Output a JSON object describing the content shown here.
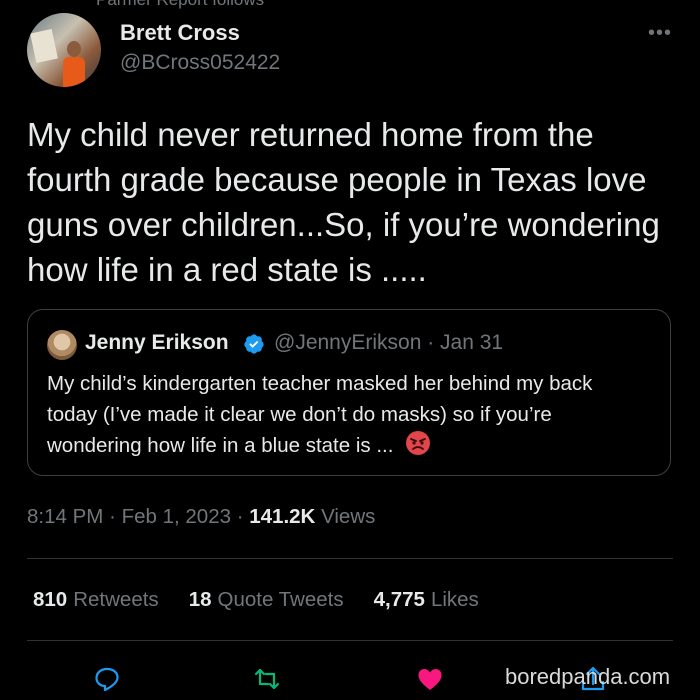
{
  "top_cut_text": "Parmer Report follows",
  "author": {
    "name": "Brett Cross",
    "handle": "@BCross052422"
  },
  "more_icon": "more-horizontal-icon",
  "tweet_text": "My child never returned home from the fourth grade because people in Texas love guns over children...So, if you’re wondering how life in a red state is .....",
  "quoted": {
    "name": "Jenny Erikson",
    "verified_icon": "verified-badge-icon",
    "handle": "@JennyErikson",
    "date": "· Jan 31",
    "text": "My child’s kindergarten teacher masked her behind my back today (I’ve made it clear we don’t do masks) so if you’re wondering how life in a blue state is ...",
    "emoji": "angry-face-emoji"
  },
  "meta": {
    "time": "8:14 PM",
    "sep1": "·",
    "date": "Feb 1, 2023",
    "sep2": "·",
    "views_count": "141.2K",
    "views_label": "Views"
  },
  "stats": {
    "retweets_count": "810",
    "retweets_label": "Retweets",
    "quotes_count": "18",
    "quotes_label": "Quote Tweets",
    "likes_count": "4,775",
    "likes_label": "Likes"
  },
  "actions": [
    "reply-icon",
    "retweet-icon",
    "like-icon",
    "share-icon"
  ],
  "colors": {
    "background": "#000000",
    "text": "#e7e9ea",
    "muted": "#71767b",
    "verified": "#1d9bf0",
    "like": "#f91880",
    "retweet": "#00ba7c"
  },
  "watermark": "boredpanda.com"
}
